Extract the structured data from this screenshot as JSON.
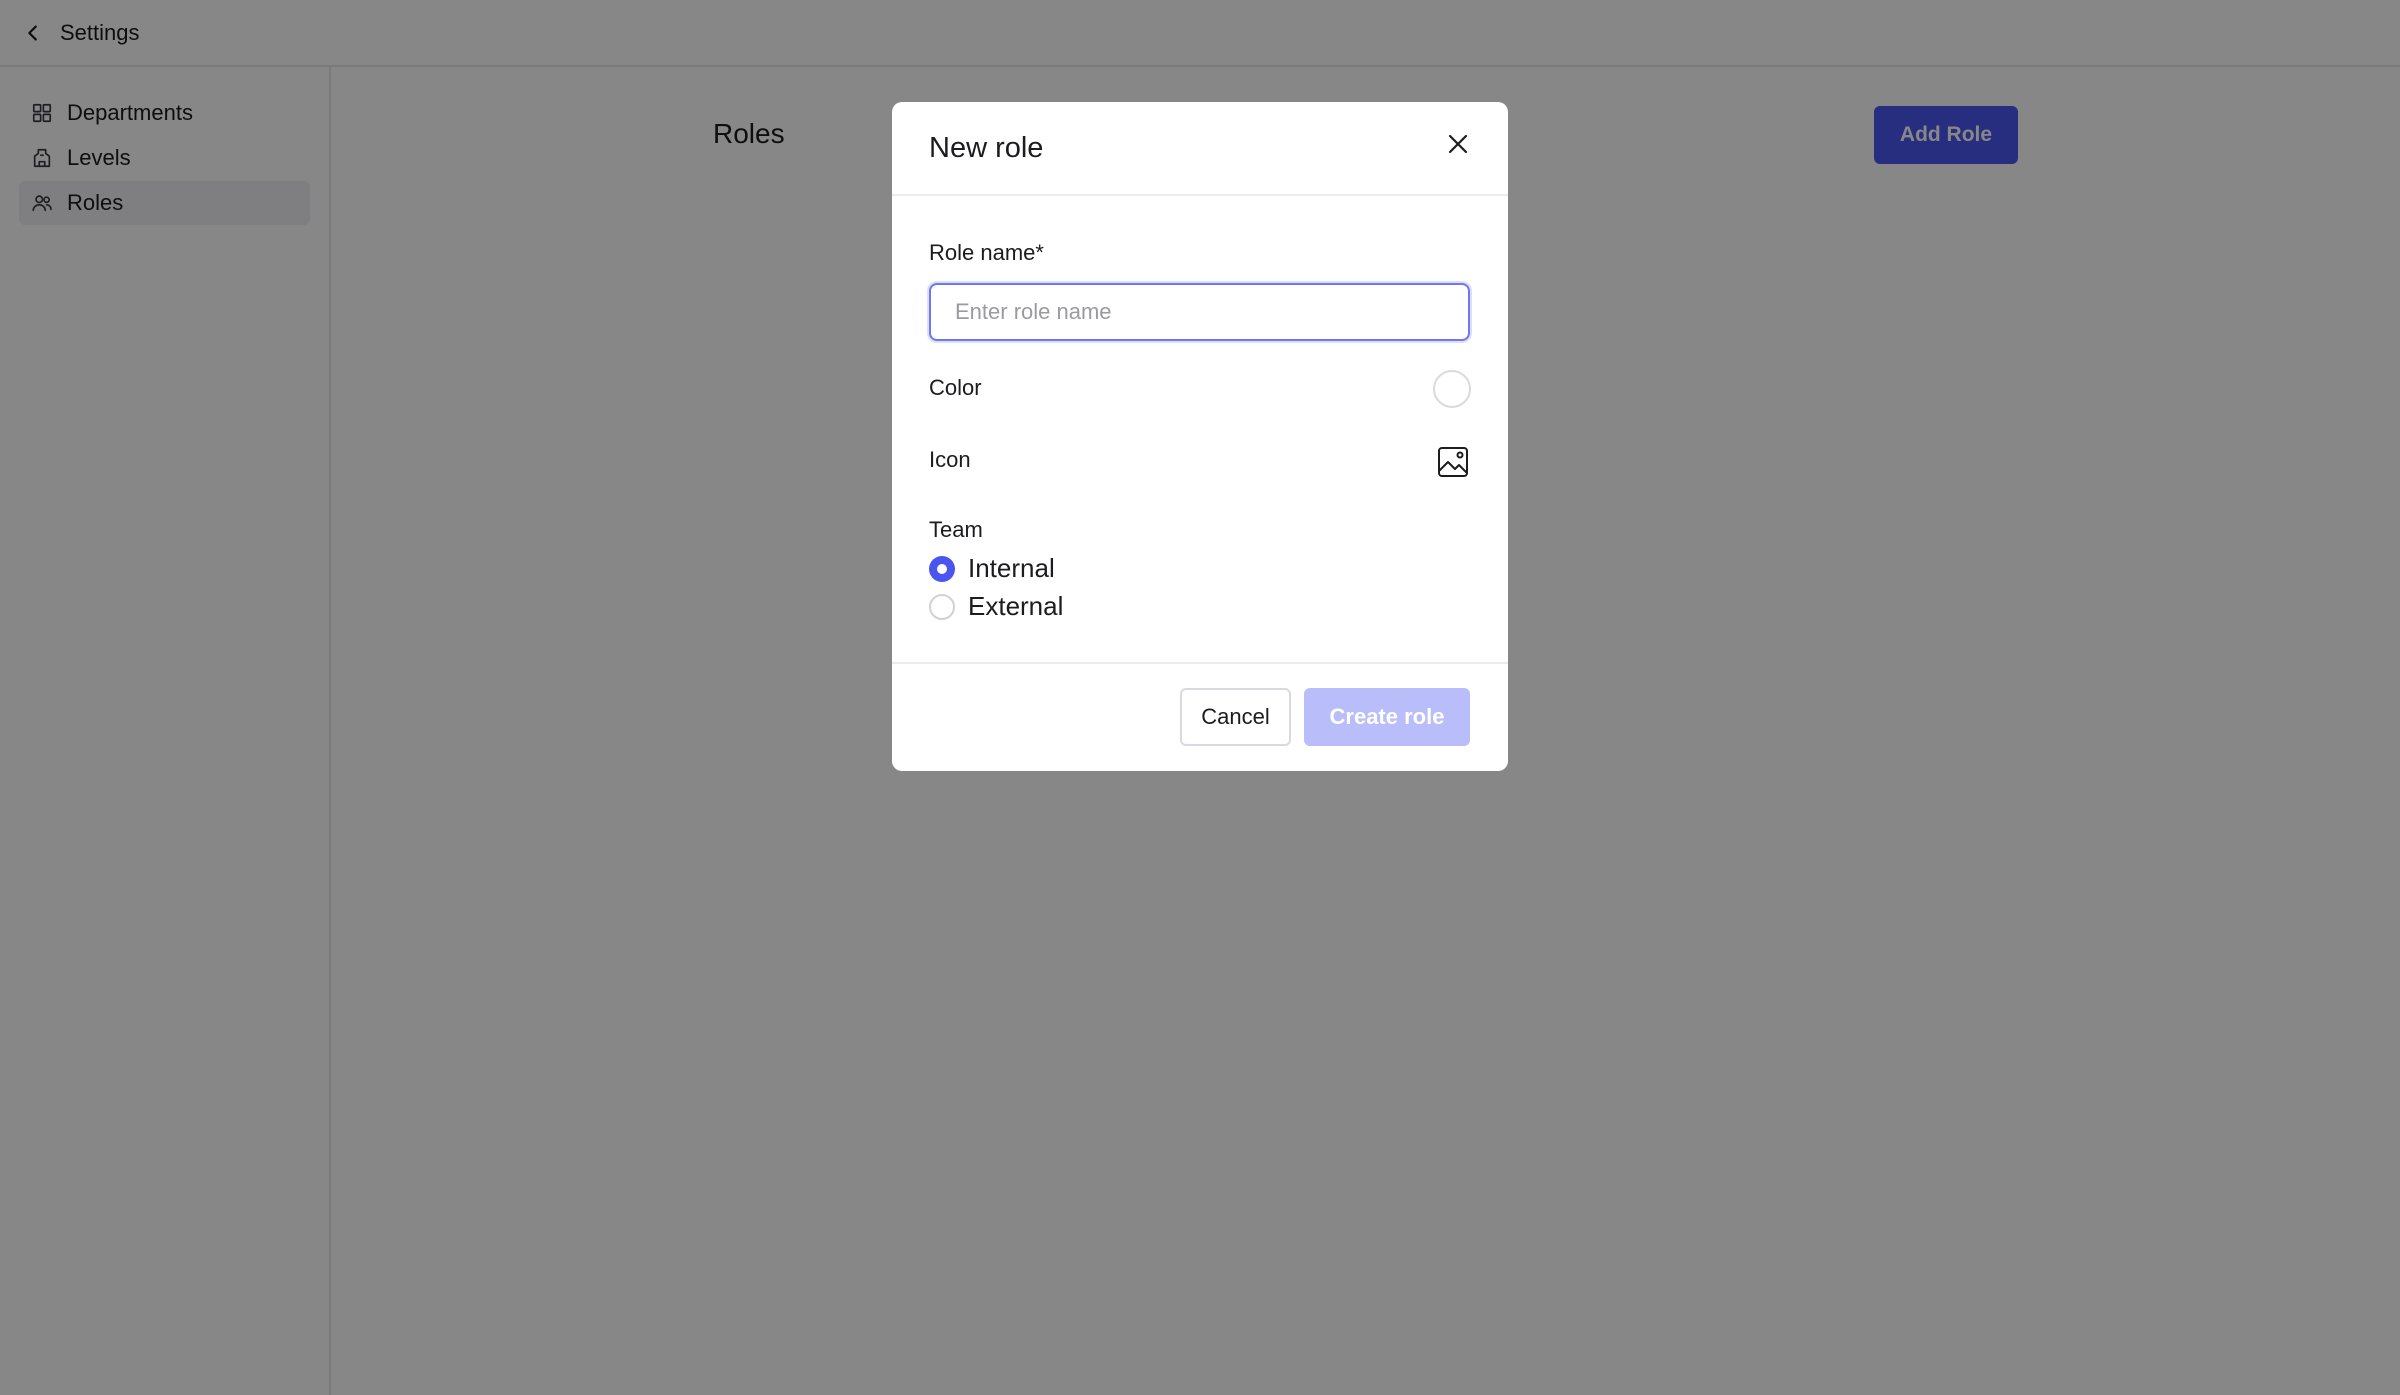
{
  "topbar": {
    "back_label": "Settings",
    "back_icon": "chevron-left-icon"
  },
  "sidebar": {
    "items": [
      {
        "label": "Departments",
        "icon": "grid-icon",
        "active": false
      },
      {
        "label": "Levels",
        "icon": "building-icon",
        "active": false
      },
      {
        "label": "Roles",
        "icon": "users-icon",
        "active": true
      }
    ]
  },
  "main": {
    "title": "Roles",
    "add_button_label": "Add Role"
  },
  "modal": {
    "title": "New role",
    "close_icon": "close-icon",
    "role_name_label": "Role name*",
    "role_name_value": "",
    "role_name_placeholder": "Enter role name",
    "color_label": "Color",
    "icon_label": "Icon",
    "icon_picker_icon": "image-icon",
    "team_label": "Team",
    "team_options": [
      {
        "label": "Internal",
        "selected": true
      },
      {
        "label": "External",
        "selected": false
      }
    ],
    "cancel_label": "Cancel",
    "create_label": "Create role"
  },
  "colors": {
    "accent": "#4a55f0",
    "accent_disabled": "#b9bdf9",
    "overlay": "rgba(0,0,0,0.47)"
  }
}
